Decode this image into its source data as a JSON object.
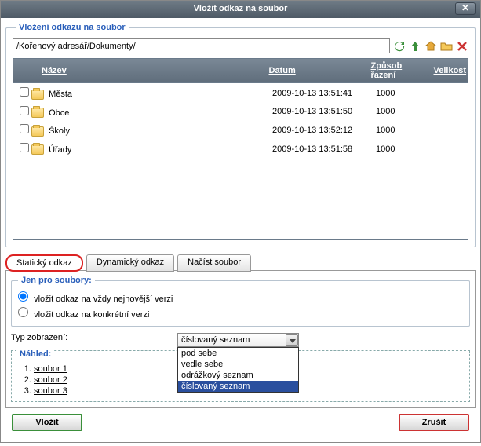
{
  "titlebar": {
    "title": "Vložit odkaz na soubor"
  },
  "fieldset_legend": "Vložení odkazu na soubor",
  "path": {
    "value": "/Kořenový adresář/Dokumenty/"
  },
  "columns": {
    "name": "Název",
    "date": "Datum",
    "sort": "Způsob řazení",
    "size": "Velikost"
  },
  "rows": [
    {
      "name": "Města",
      "date": "2009-10-13 13:51:41",
      "sort": "1000",
      "size": ""
    },
    {
      "name": "Obce",
      "date": "2009-10-13 13:51:50",
      "sort": "1000",
      "size": ""
    },
    {
      "name": "Školy",
      "date": "2009-10-13 13:52:12",
      "sort": "1000",
      "size": ""
    },
    {
      "name": "Úřady",
      "date": "2009-10-13 13:51:58",
      "sort": "1000",
      "size": ""
    }
  ],
  "tabs": {
    "t1": "Statický odkaz",
    "t2": "Dynamický odkaz",
    "t3": "Načíst soubor"
  },
  "files_only": {
    "legend": "Jen pro soubory:",
    "opt1": "vložit odkaz na vždy nejnovější verzi",
    "opt2": "vložit odkaz na konkrétní verzi"
  },
  "typ_label": "Typ zobrazení:",
  "combo_value": "číslovaný seznam",
  "dropdown": [
    "pod sebe",
    "vedle sebe",
    "odrážkový seznam",
    "číslovaný seznam"
  ],
  "preview": {
    "legend": "Náhled:",
    "items": [
      "soubor 1",
      "soubor 2",
      "soubor 3"
    ]
  },
  "buttons": {
    "insert": "Vložit",
    "cancel": "Zrušit"
  }
}
